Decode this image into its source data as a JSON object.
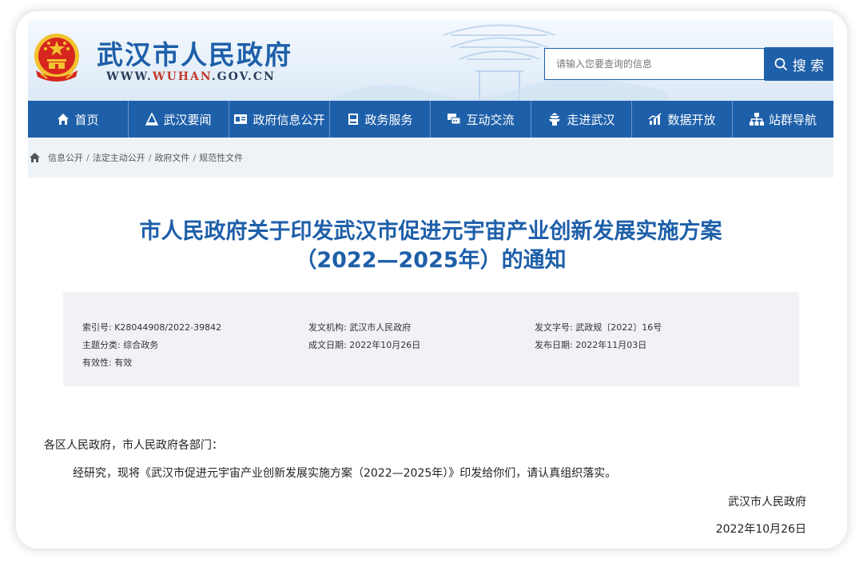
{
  "header": {
    "site_name": "武汉市人民政府",
    "url_prefix": "WWW.",
    "url_highlight": "WUHAN",
    "url_suffix": ".GOV.CN",
    "search_placeholder": "请输入您要查询的信息",
    "search_button": "搜 索"
  },
  "nav": [
    {
      "label": "首页",
      "icon": "home-icon"
    },
    {
      "label": "武汉要闻",
      "icon": "news-icon"
    },
    {
      "label": "政府信息公开",
      "icon": "info-card-icon"
    },
    {
      "label": "政务服务",
      "icon": "save-icon"
    },
    {
      "label": "互动交流",
      "icon": "chat-icon"
    },
    {
      "label": "走进武汉",
      "icon": "tower-icon"
    },
    {
      "label": "数据开放",
      "icon": "chart-icon"
    },
    {
      "label": "站群导航",
      "icon": "sitemap-icon"
    }
  ],
  "breadcrumb": [
    "信息公开",
    "法定主动公开",
    "政府文件",
    "规范性文件"
  ],
  "breadcrumb_sep": "/",
  "title_line1": "市人民政府关于印发武汉市促进元宇宙产业创新发展实施方案",
  "title_line2": "（2022—2025年）的通知",
  "meta": {
    "index_no": "索引号:  K28044908/2022-39842",
    "category": "主题分类:  综合政务",
    "validity": "有效性:  有效",
    "issuer": "发文机构:  武汉市人民政府",
    "written_date": "成文日期:  2022年10月26日",
    "doc_no": "发文字号:  武政规〔2022〕16号",
    "publish_date": "发布日期:  2022年11月03日"
  },
  "body": {
    "salutation": "各区人民政府，市人民政府各部门：",
    "paragraph": "经研究，现将《武汉市促进元宇宙产业创新发展实施方案（2022—2025年）》印发给你们，请认真组织落实。",
    "signature": "武汉市人民政府",
    "date": "2022年10月26日"
  },
  "colors": {
    "brand_blue": "#1e5fa9",
    "emblem_red": "#d7261e",
    "emblem_gold": "#f2c230"
  }
}
